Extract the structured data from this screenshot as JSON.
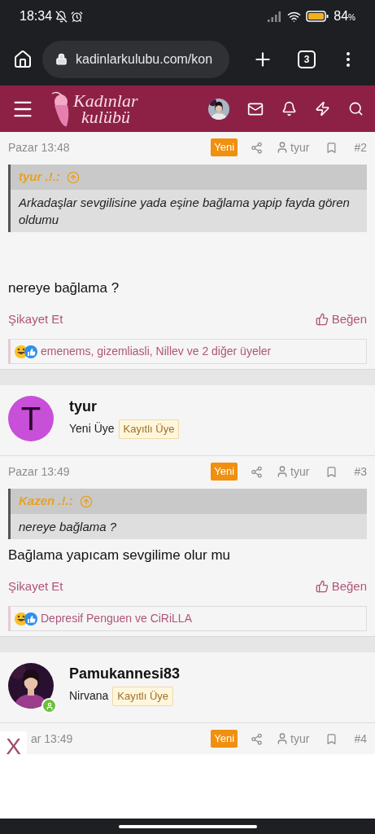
{
  "status_bar": {
    "time": "18:34",
    "battery": "84",
    "battery_unit": "%"
  },
  "browser": {
    "url": "kadinlarkulubu.com/kon",
    "tab_count": "3"
  },
  "site_header": {
    "logo_line1": "Kadınlar",
    "logo_line2": "kulübü"
  },
  "posts": [
    {
      "meta": {
        "time": "Pazar 13:48",
        "badge": "Yeni",
        "author": "tyur",
        "number": "#2"
      },
      "quote": {
        "author": "tyur .!.:",
        "text": "Arkadaşlar sevgilisine yada eşine bağlama yapip fayda gören oldumu"
      },
      "body": "nereye bağlama ?",
      "report": "Şikayet Et",
      "like": "Beğen",
      "reactions": "emenems, gizemliasli, Nillev ve 2 diğer üyeler"
    },
    {
      "user": {
        "kind": "letter",
        "initial": "T",
        "name": "tyur",
        "title": "Yeni Üye",
        "badge": "Kayıtlı Üye",
        "online": false
      },
      "meta": {
        "time": "Pazar 13:49",
        "badge": "Yeni",
        "author": "tyur",
        "number": "#3"
      },
      "quote": {
        "author": "Kazen .!.:",
        "text": "nereye bağlama ?"
      },
      "body": "Bağlama yapıcam sevgilime olur mu",
      "report": "Şikayet Et",
      "like": "Beğen",
      "reactions": "Depresif Penguen ve CiRiLLA"
    },
    {
      "user": {
        "kind": "picture",
        "name": "Pamukannesi83",
        "title": "Nirvana",
        "badge": "Kayıtlı Üye",
        "online": true
      },
      "meta": {
        "time": "ar 13:49",
        "badge": "Yeni",
        "author": "tyur",
        "number": "#4"
      }
    }
  ],
  "overlay": {
    "close": "X"
  }
}
